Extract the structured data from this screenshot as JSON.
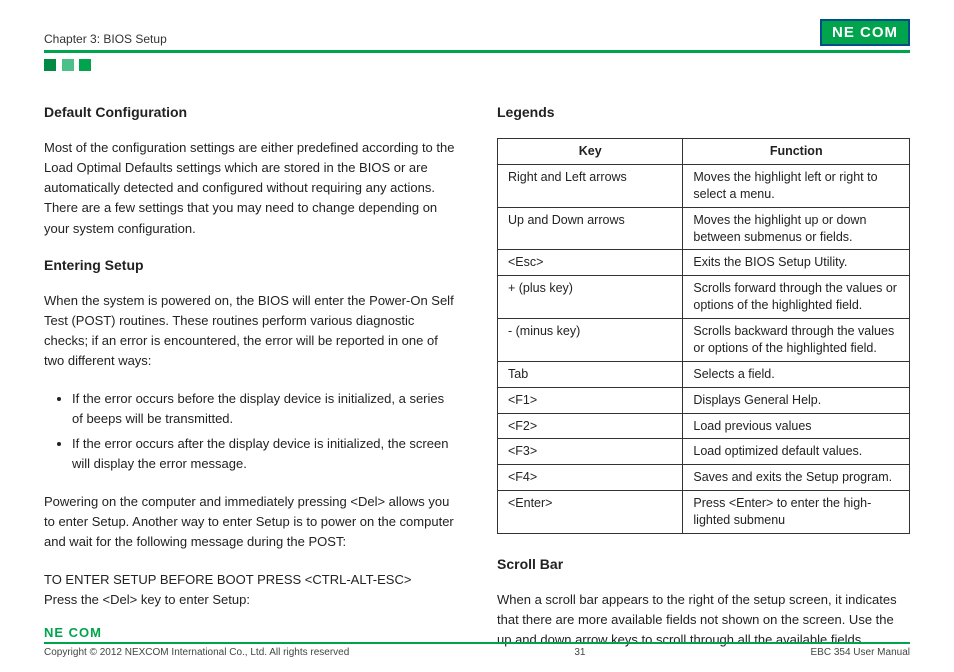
{
  "header": {
    "chapter": "Chapter 3: BIOS Setup",
    "logoText": "NE COM"
  },
  "left": {
    "h1": "Default Configuration",
    "p1": "Most of the configuration settings are either predefined according to the Load Optimal Defaults settings which are stored in the BIOS or are automatically detected and configured without requiring any actions. There are a few settings that you may need to change depending on your system configuration.",
    "h2": "Entering Setup",
    "p2": "When the system is powered on, the BIOS will enter the Power-On Self Test (POST) routines. These routines perform various diagnostic checks; if an error is encountered, the error will be reported in one of two different ways:",
    "b1": "If the error occurs before the display device is initialized, a series of beeps will be transmitted.",
    "b2": "If the error occurs after the display device is initialized, the screen will display the error message.",
    "p3": "Powering on the computer and immediately pressing <Del> allows you to enter Setup. Another way to enter Setup is to power on the computer and wait for the following message during the POST:",
    "p4": "TO ENTER SETUP BEFORE BOOT PRESS <CTRL-ALT-ESC>",
    "p5": "Press the <Del> key to enter Setup:"
  },
  "right": {
    "h1": "Legends",
    "thKey": "Key",
    "thFunc": "Function",
    "rows": [
      {
        "k": "Right and Left arrows",
        "f": "Moves the highlight left or right to select a menu."
      },
      {
        "k": "Up and Down arrows",
        "f": "Moves the highlight up or down between submenus or fields."
      },
      {
        "k": "<Esc>",
        "f": "Exits the BIOS Setup Utility."
      },
      {
        "k": "+ (plus key)",
        "f": "Scrolls forward through the values or options of the highlighted field."
      },
      {
        "k": "- (minus key)",
        "f": "Scrolls backward through the values or options of the highlighted field."
      },
      {
        "k": "Tab",
        "f": "Selects a field."
      },
      {
        "k": "<F1>",
        "f": "Displays General Help."
      },
      {
        "k": "<F2>",
        "f": "Load previous values"
      },
      {
        "k": "<F3>",
        "f": "Load optimized default values."
      },
      {
        "k": "<F4>",
        "f": "Saves and exits the Setup program."
      },
      {
        "k": "<Enter>",
        "f": "Press <Enter> to enter the high-lighted submenu"
      }
    ],
    "h2": "Scroll Bar",
    "p1": "When a scroll bar appears to the right of the setup screen, it indicates that there are more available fields not shown on the screen. Use the up and down arrow keys to scroll through all the available fields."
  },
  "footer": {
    "logoText": "NE COM",
    "copyright": "Copyright © 2012 NEXCOM International Co., Ltd. All rights reserved",
    "page": "31",
    "doc": "EBC 354 User Manual"
  }
}
